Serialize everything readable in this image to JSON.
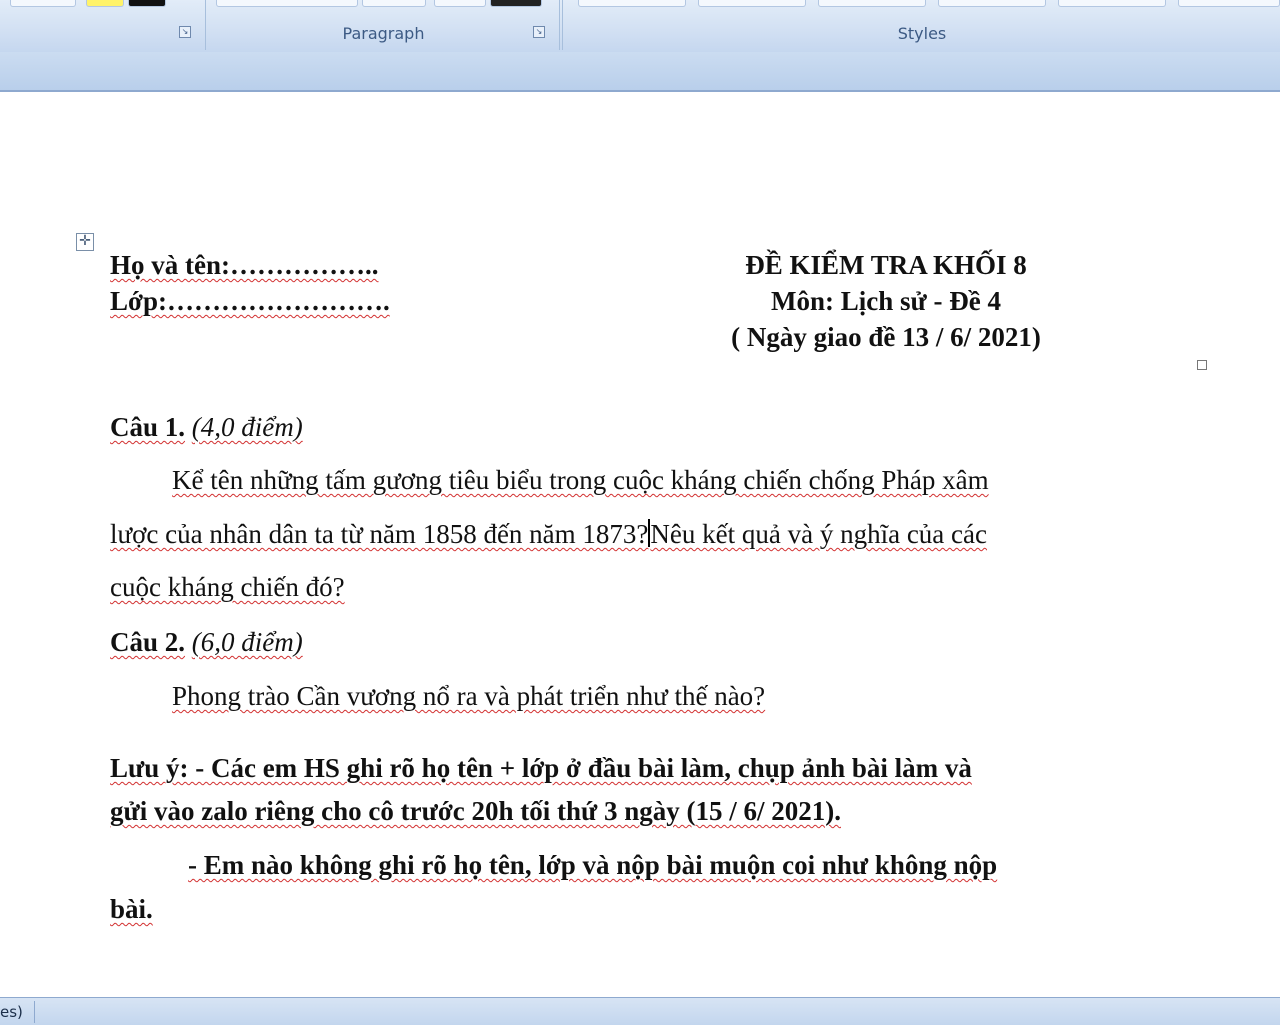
{
  "ribbon": {
    "groups": [
      {
        "label": ""
      },
      {
        "label": "Paragraph"
      },
      {
        "label": "Styles"
      }
    ],
    "launcher_glyph": "↘"
  },
  "document": {
    "left_header": {
      "name_line": "Họ và tên:……………..",
      "class_line": "Lớp:……………………."
    },
    "right_header": {
      "title": "ĐỀ KIỂM TRA KHỐI 8",
      "subject": "Môn: Lịch sử - Đề 4",
      "date": "( Ngày giao đề 13 / 6/ 2021)"
    },
    "q1": {
      "label": "Câu 1.",
      "points": "(4,0 điểm)",
      "text_line1": "Kể tên những tấm gương tiêu biểu trong cuộc kháng chiến chống Pháp xâm",
      "text_line2a": "lược của nhân dân ta từ năm 1858 đến năm 1873?",
      "text_line2b": "Nêu kết quả và ý nghĩa của các",
      "text_line3": "cuộc kháng chiến đó?"
    },
    "q2": {
      "label": "Câu 2.",
      "points": "(6,0 điểm)",
      "text": "Phong trào Cần vương nổ ra và phát triển như thế nào?"
    },
    "note": {
      "line1": "Lưu ý: - Các em HS ghi rõ họ tên + lớp ở đầu bài làm, chụp ảnh bài làm và",
      "line2": "gửi vào zalo riêng cho cô trước 20h tối thứ 3 ngày (15 / 6/ 2021).",
      "line3": "- Em nào không ghi rõ họ tên, lớp và nộp bài muộn coi như không nộp",
      "line4": "bài."
    },
    "table_handle_glyph": "✛"
  },
  "statusbar": {
    "text": "es)"
  }
}
